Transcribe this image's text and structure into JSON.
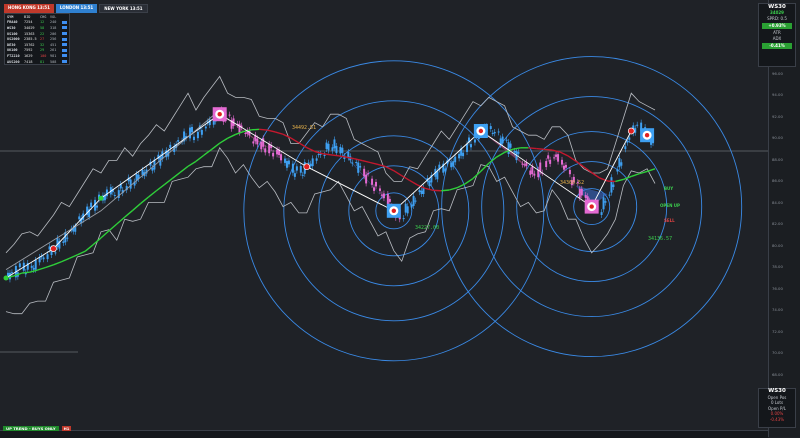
{
  "sessions": {
    "hk": "HONG KONG 13:51",
    "london": "LONDON 13:51",
    "newyork": "NEW YORK 13:51"
  },
  "watchlist": {
    "headers": [
      "SYM",
      "BID",
      "CHG",
      "VOL"
    ],
    "rows": [
      {
        "sym": "FRA40",
        "bid": "7254",
        "chg": "12",
        "vol": "240",
        "dir": "up"
      },
      {
        "sym": "WS30",
        "bid": "34029",
        "chg": "58",
        "vol": "318",
        "dir": "up"
      },
      {
        "sym": "US100",
        "bid": "15363",
        "chg": "22",
        "vol": "206",
        "dir": "up"
      },
      {
        "sym": "US2000",
        "bid": "2385.5",
        "chg": "27",
        "vol": "256",
        "dir": "dn"
      },
      {
        "sym": "DE30",
        "bid": "15762",
        "chg": "32",
        "vol": "451",
        "dir": "up"
      },
      {
        "sym": "UK100",
        "bid": "7592",
        "chg": "29",
        "vol": "261",
        "dir": "up"
      },
      {
        "sym": "FT2210",
        "bid": "1629",
        "chg": "100",
        "vol": "981",
        "dir": "dn"
      },
      {
        "sym": "AUS200",
        "bid": "7418",
        "chg": "81",
        "vol": "508",
        "dir": "up"
      }
    ]
  },
  "top_panel": {
    "symbol": "WS30",
    "price": "34029",
    "spread": "SPRD: 0.5",
    "change": "+0.93%",
    "change2": "-0.41%",
    "l1": "ATR",
    "l2": "ADX",
    "l3": "RSI",
    "l4": "STO"
  },
  "bottom_panel": {
    "symbol": "WS30",
    "l1": "Open Pos",
    "l2": "0 Lots",
    "l3": "Open P/L",
    "l4": "0.00%",
    "l5": "Day P/L",
    "l6": "-0.43%"
  },
  "trend_label": "UP TREND - BUYS ONLY",
  "timeframe_label": "H1",
  "signals": {
    "buy": "BUY",
    "sell": "SELL",
    "open": "OPEN UP"
  },
  "price_labels": {
    "a": "34492.51",
    "b": "34227.00",
    "c": "34360.52",
    "d": "34136.57"
  },
  "price_axis": [
    "102.00",
    "100.00",
    "98.00",
    "96.00",
    "94.00",
    "92.00",
    "90.00",
    "88.00",
    "86.00",
    "84.00",
    "82.00",
    "80.00",
    "78.00",
    "76.00",
    "74.00",
    "72.00",
    "70.00",
    "68.00",
    "66.00",
    "64.00"
  ],
  "colors": {
    "bull": "#3ea0f2",
    "bear": "#e46ad2",
    "ma_up": "#2fcf3a",
    "ma_down": "#c4182e",
    "circles": "#3a8ae6",
    "zigzag": "#ffffff"
  },
  "chart_data": {
    "type": "candlestick",
    "series": [
      {
        "name": "price",
        "values": [
          20,
          22,
          25,
          24,
          28,
          31,
          34,
          38,
          42,
          46,
          50,
          54,
          58,
          62,
          60,
          64,
          66,
          70,
          72,
          75,
          78,
          82,
          86,
          90,
          88,
          92,
          95,
          98,
          96,
          92,
          90,
          87,
          85,
          82,
          80,
          76,
          72,
          70,
          73,
          76,
          80,
          84,
          82,
          78,
          74,
          70,
          66,
          62,
          58,
          52,
          50,
          55,
          60,
          64,
          68,
          72,
          74,
          78,
          82,
          86,
          90,
          92,
          88,
          84,
          80,
          76,
          72,
          70,
          74,
          78,
          76,
          70,
          64,
          58,
          54,
          52,
          60,
          70,
          80,
          90,
          92,
          88,
          84
        ]
      }
    ]
  }
}
